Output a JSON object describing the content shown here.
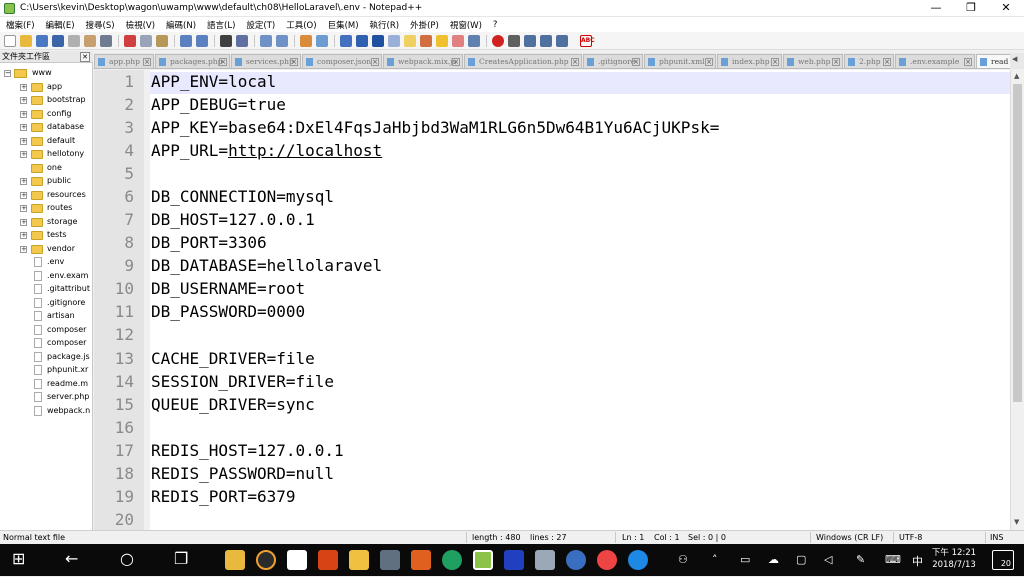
{
  "window": {
    "title": "C:\\Users\\kevin\\Desktop\\wagon\\uwamp\\www\\default\\ch08\\HelloLaravel\\.env - Notepad++",
    "controls": [
      "—",
      "❐",
      "✕"
    ]
  },
  "menu": [
    "檔案(F)",
    "編輯(E)",
    "搜尋(S)",
    "檢視(V)",
    "編碼(N)",
    "語言(L)",
    "設定(T)",
    "工具(O)",
    "巨集(M)",
    "執行(R)",
    "外掛(P)",
    "視窗(W)",
    "?"
  ],
  "folder_panel": {
    "title": "文件夾工作區",
    "close": "✕",
    "root": "www",
    "folders": [
      "app",
      "bootstrap",
      "config",
      "database",
      "default",
      "hellotony",
      "one",
      "public",
      "resources",
      "routes",
      "storage",
      "tests",
      "vendor"
    ],
    "files": [
      ".env",
      ".env.exam",
      ".gitattribut",
      ".gitignore",
      "artisan",
      "composer",
      "composer",
      "package.js",
      "phpunit.xr",
      "readme.m",
      "server.php",
      "webpack.n"
    ]
  },
  "tabs": [
    {
      "label": "app.php"
    },
    {
      "label": "packages.php"
    },
    {
      "label": "services.php"
    },
    {
      "label": "composer.json"
    },
    {
      "label": "webpack.mix.js"
    },
    {
      "label": "CreatesApplication.php"
    },
    {
      "label": ".gitignore"
    },
    {
      "label": "phpunit.xml"
    },
    {
      "label": "index.php"
    },
    {
      "label": "web.php"
    },
    {
      "label": "2.php"
    },
    {
      "label": ".env.example"
    },
    {
      "label": "read"
    }
  ],
  "editor": {
    "lines": [
      {
        "n": "1",
        "text": "APP_ENV=local"
      },
      {
        "n": "2",
        "text": "APP_DEBUG=true"
      },
      {
        "n": "3",
        "text": "APP_KEY=base64:DxEl4FqsJaHbjbd3WaM1RLG6n5Dw64B1Yu6ACjUKPsk="
      },
      {
        "n": "4",
        "text": "APP_URL=",
        "url": "http://localhost"
      },
      {
        "n": "5",
        "text": ""
      },
      {
        "n": "6",
        "text": "DB_CONNECTION=mysql"
      },
      {
        "n": "7",
        "text": "DB_HOST=127.0.0.1"
      },
      {
        "n": "8",
        "text": "DB_PORT=3306"
      },
      {
        "n": "9",
        "text": "DB_DATABASE=hellolaravel"
      },
      {
        "n": "10",
        "text": "DB_USERNAME=root"
      },
      {
        "n": "11",
        "text": "DB_PASSWORD=0000"
      },
      {
        "n": "12",
        "text": ""
      },
      {
        "n": "13",
        "text": "CACHE_DRIVER=file"
      },
      {
        "n": "14",
        "text": "SESSION_DRIVER=file"
      },
      {
        "n": "15",
        "text": "QUEUE_DRIVER=sync"
      },
      {
        "n": "16",
        "text": ""
      },
      {
        "n": "17",
        "text": "REDIS_HOST=127.0.0.1"
      },
      {
        "n": "18",
        "text": "REDIS_PASSWORD=null"
      },
      {
        "n": "19",
        "text": "REDIS_PORT=6379"
      },
      {
        "n": "20",
        "text": ""
      }
    ]
  },
  "status": {
    "mode": "Normal text file",
    "length": "length : 480",
    "lines": "lines : 27",
    "ln": "Ln : 1",
    "col": "Col : 1",
    "sel": "Sel : 0 | 0",
    "eol": "Windows (CR LF)",
    "encoding": "UTF-8",
    "ins": "INS"
  },
  "taskbar": {
    "ime": "中",
    "time": "下午 12:21",
    "date": "2018/7/13",
    "notifications": "20"
  }
}
